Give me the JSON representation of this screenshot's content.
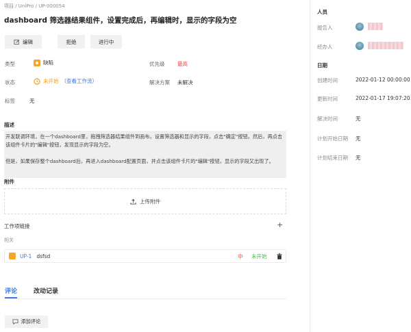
{
  "breadcrumb": "项目 / UniPro / UP-000054",
  "title": "dashboard 筛选器结果组件，设置完成后，再编辑时，显示的字段为空",
  "toolbar": {
    "edit_label": "编辑",
    "reject_label": "拒绝",
    "progress_label": "进行中"
  },
  "props": {
    "type_label": "类型",
    "type_value": "缺陷",
    "priority_label": "优先级",
    "priority_value": "最高",
    "status_label": "状态",
    "status_value": "未开始",
    "status_link": "（查看工作流）",
    "resolution_label": "解决方案",
    "resolution_value": "未解决",
    "tags_label": "标签",
    "tags_value": "无"
  },
  "description": {
    "title": "描述",
    "para1": "开发联调环境，在一个dashboard里，拖拽筛选器结果组件到画布，设置筛选器和显示的字段，点击\"确定\"按钮。然后，再点击该组件卡片的\"编辑\"按钮，发现显示的字段为空。",
    "para2": "但是，如果保存整个dashboard后，再进入dashboard配置页面，并点击该组件卡片的\"编辑\"按钮，显示的字段又出现了。"
  },
  "attachments": {
    "title": "附件",
    "upload_label": "上传附件"
  },
  "links": {
    "title": "工作项链接",
    "add_icon": "plus-icon",
    "related_label": "相关",
    "rows": [
      {
        "id": "UP-1",
        "title": "dsfsd",
        "priority": "中",
        "status": "未开始"
      }
    ]
  },
  "tabs": {
    "comments": "评论",
    "history": "改动记录"
  },
  "comment_button": "添加评论",
  "sidebar": {
    "people_title": "人员",
    "reporter_label": "报告人",
    "assignee_label": "经办人",
    "dates_title": "日期",
    "created_label": "创建时间",
    "created_value": "2022-01-12 00:00:00",
    "updated_label": "更新时间",
    "updated_value": "2022-01-17 19:07:20",
    "resolved_label": "解决时间",
    "resolved_value": "无",
    "plan_start_label": "计划开始日期",
    "plan_start_value": "无",
    "plan_end_label": "计划结束日期",
    "plan_end_value": "无"
  },
  "colors": {
    "accent": "#3b78e7",
    "priority_high": "#e5443e",
    "status_todo": "#f0a020",
    "status_green": "#52b45a",
    "bug": "#f5a623"
  }
}
